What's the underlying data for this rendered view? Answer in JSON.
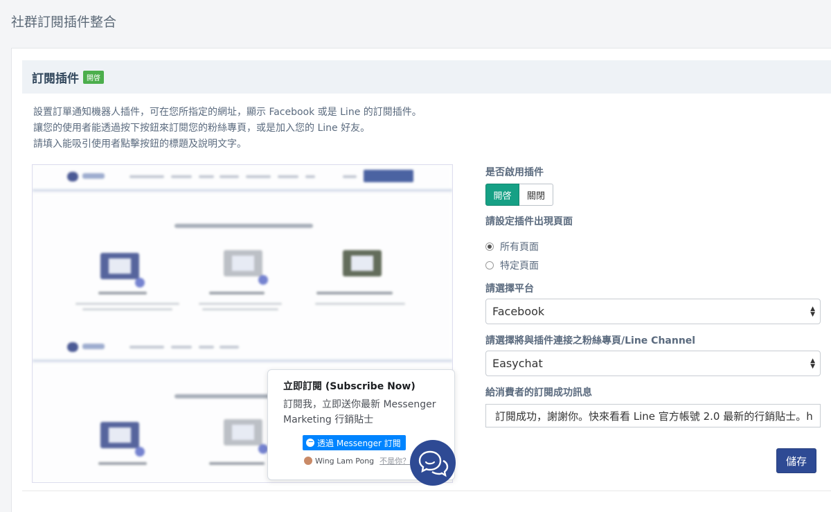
{
  "page": {
    "title": "社群訂閱插件整合"
  },
  "card": {
    "title": "訂閱插件",
    "badge": "開啓",
    "description": [
      "設置訂單通知機器人插件，可在您所指定的網址，顯示 Facebook 或是 Line 的訂閱插件。",
      "讓您的使用者能透過按下按鈕來訂閱您的粉絲專頁，或是加入您的 Line 好友。",
      "請填入能吸引使用者點擊按鈕的標題及說明文字。"
    ]
  },
  "preview": {
    "popup_title": "立即訂閱 (Subscribe Now)",
    "popup_body": "訂閱我，立即送你最新 Messenger Marketing 行銷貼士",
    "messenger_button": "透過 Messenger 訂閱",
    "user_name": "Wing Lam Pong",
    "not_you": "不是你？"
  },
  "form": {
    "enable_label": "是否啟用插件",
    "toggle_on": "開啓",
    "toggle_off": "關閉",
    "toggle_state": "on",
    "pages_label": "請設定插件出現頁面",
    "radio_all": "所有頁面",
    "radio_specific": "特定頁面",
    "radio_selected": "all",
    "platform_label": "請選擇平台",
    "platform_value": "Facebook",
    "fanpage_label": "請選擇將與插件連接之粉絲專頁/Line Channel",
    "fanpage_value": "Easychat",
    "message_label": "給消費者的訂閱成功訊息",
    "message_value": "訂閱成功，謝謝你。快來看看 Line 官方帳號 2.0 最新的行銷貼士。h",
    "save": "儲存"
  },
  "colors": {
    "primary": "#2e4a94",
    "toggle_on": "#16a085",
    "badge": "#4cae4c",
    "messenger": "#0084ff"
  }
}
